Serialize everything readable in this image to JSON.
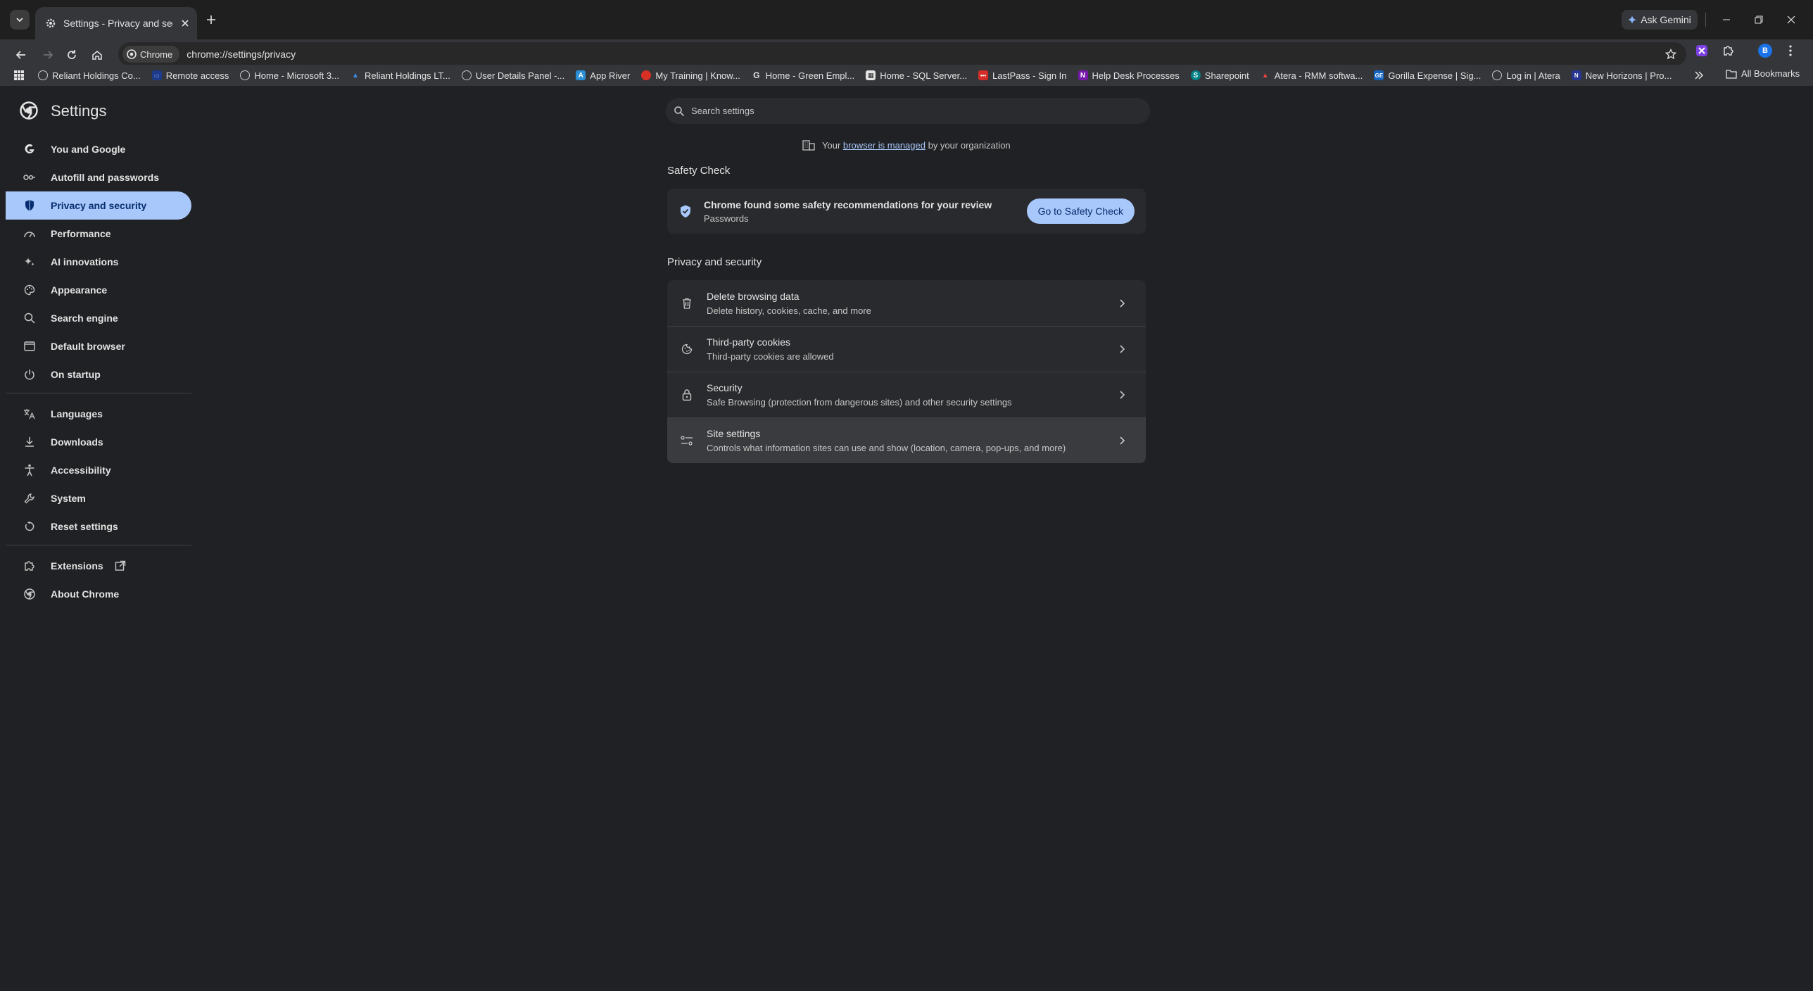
{
  "browser": {
    "tab_title": "Settings - Privacy and security",
    "ask_gemini": "Ask Gemini",
    "site_chip": "Chrome",
    "url": "chrome://settings/privacy",
    "profile_initial": "B"
  },
  "bookmarks": {
    "items": [
      {
        "label": "Reliant Holdings Co...",
        "icon": "globe-icon"
      },
      {
        "label": "Remote access",
        "icon": "remote-icon"
      },
      {
        "label": "Home - Microsoft 3...",
        "icon": "globe-icon"
      },
      {
        "label": "Reliant Holdings LT...",
        "icon": "azure-icon"
      },
      {
        "label": "User Details Panel -...",
        "icon": "globe-icon"
      },
      {
        "label": "App River",
        "icon": "appriver-icon"
      },
      {
        "label": "My Training | Know...",
        "icon": "training-icon"
      },
      {
        "label": "Home - Green Empl...",
        "icon": "google-icon"
      },
      {
        "label": "Home - SQL Server...",
        "icon": "sql-icon"
      },
      {
        "label": "LastPass - Sign In",
        "icon": "lastpass-icon"
      },
      {
        "label": "Help Desk Processes",
        "icon": "onenote-icon"
      },
      {
        "label": "Sharepoint",
        "icon": "sharepoint-icon"
      },
      {
        "label": "Atera - RMM softwa...",
        "icon": "atera-icon"
      },
      {
        "label": "Gorilla Expense | Sig...",
        "icon": "gorilla-icon"
      },
      {
        "label": "Log in | Atera",
        "icon": "globe-icon"
      },
      {
        "label": "New Horizons | Pro...",
        "icon": "horizons-icon"
      }
    ],
    "all_bookmarks": "All Bookmarks"
  },
  "settings": {
    "title": "Settings",
    "search_placeholder": "Search settings"
  },
  "sidebar": {
    "items": [
      {
        "label": "You and Google",
        "icon": "google-g-icon"
      },
      {
        "label": "Autofill and passwords",
        "icon": "key-icon"
      },
      {
        "label": "Privacy and security",
        "icon": "shield-icon"
      },
      {
        "label": "Performance",
        "icon": "speedometer-icon"
      },
      {
        "label": "AI innovations",
        "icon": "sparkle-icon"
      },
      {
        "label": "Appearance",
        "icon": "palette-icon"
      },
      {
        "label": "Search engine",
        "icon": "search-icon"
      },
      {
        "label": "Default browser",
        "icon": "browser-window-icon"
      },
      {
        "label": "On startup",
        "icon": "power-icon"
      },
      {
        "label": "Languages",
        "icon": "translate-icon"
      },
      {
        "label": "Downloads",
        "icon": "download-icon"
      },
      {
        "label": "Accessibility",
        "icon": "accessibility-icon"
      },
      {
        "label": "System",
        "icon": "wrench-icon"
      },
      {
        "label": "Reset settings",
        "icon": "reset-icon"
      },
      {
        "label": "Extensions",
        "icon": "puzzle-icon"
      },
      {
        "label": "About Chrome",
        "icon": "chrome-icon"
      }
    ]
  },
  "main": {
    "managed": {
      "prefix": "Your",
      "link": "browser is managed",
      "suffix": "by your organization"
    },
    "safety_check": {
      "heading": "Safety Check",
      "title": "Chrome found some safety recommendations for your review",
      "subtitle": "Passwords",
      "button": "Go to Safety Check"
    },
    "privacy": {
      "heading": "Privacy and security",
      "rows": [
        {
          "title": "Delete browsing data",
          "subtitle": "Delete history, cookies, cache, and more",
          "icon": "trash-icon"
        },
        {
          "title": "Third-party cookies",
          "subtitle": "Third-party cookies are allowed",
          "icon": "cookie-icon"
        },
        {
          "title": "Security",
          "subtitle": "Safe Browsing (protection from dangerous sites) and other security settings",
          "icon": "lock-icon"
        },
        {
          "title": "Site settings",
          "subtitle": "Controls what information sites can use and show (location, camera, pop-ups, and more)",
          "icon": "tune-icon"
        }
      ]
    }
  }
}
